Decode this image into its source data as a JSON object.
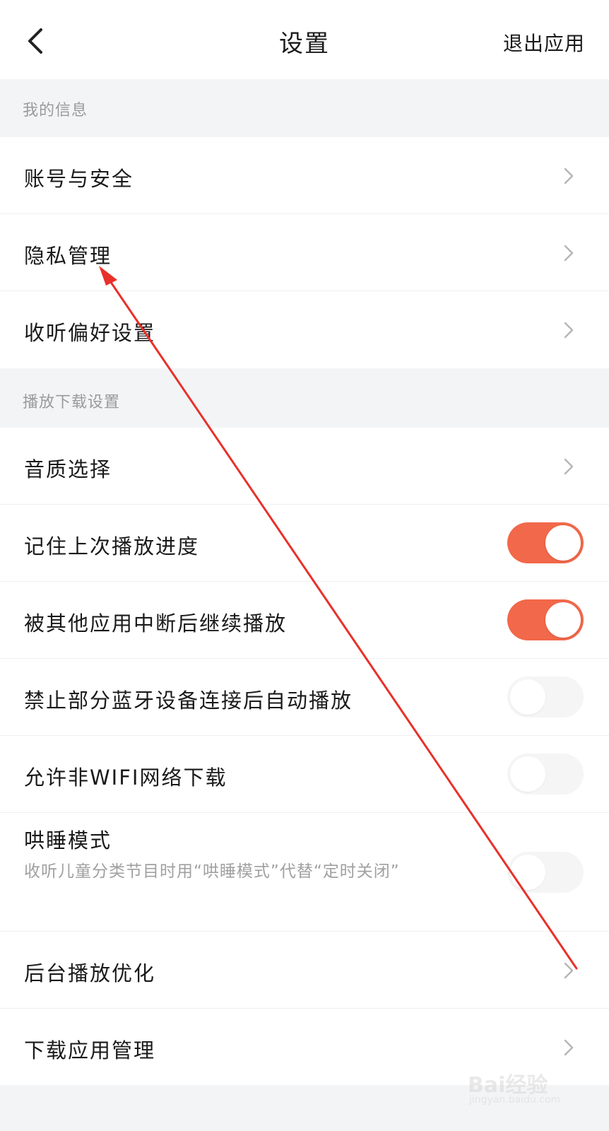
{
  "header": {
    "title": "设置",
    "exit_label": "退出应用"
  },
  "sections": [
    {
      "title": "我的信息"
    },
    {
      "title": "播放下载设置"
    }
  ],
  "rows": [
    {
      "label": "账号与安全",
      "control": "chevron"
    },
    {
      "label": "隐私管理",
      "control": "chevron"
    },
    {
      "label": "收听偏好设置",
      "control": "chevron"
    },
    {
      "label": "音质选择",
      "control": "chevron"
    },
    {
      "label": "记住上次播放进度",
      "control": "toggle",
      "on": true
    },
    {
      "label": "被其他应用中断后继续播放",
      "control": "toggle",
      "on": true
    },
    {
      "label": "禁止部分蓝牙设备连接后自动播放",
      "control": "toggle",
      "on": false
    },
    {
      "label": "允许非WIFI网络下载",
      "control": "toggle",
      "on": false
    },
    {
      "label": "哄睡模式",
      "description": "收听儿童分类节目时用“哄睡模式”代替“定时关闭”",
      "control": "toggle",
      "on": false
    },
    {
      "label": "后台播放优化",
      "control": "chevron"
    },
    {
      "label": "下载应用管理",
      "control": "chevron"
    }
  ],
  "colors": {
    "toggle_on": "#f2684a",
    "toggle_off": "#f0f0f0",
    "annotation_arrow": "#e8312a"
  },
  "watermark": {
    "brand": "Bai经验",
    "url": "jingyan.baidu.com"
  }
}
